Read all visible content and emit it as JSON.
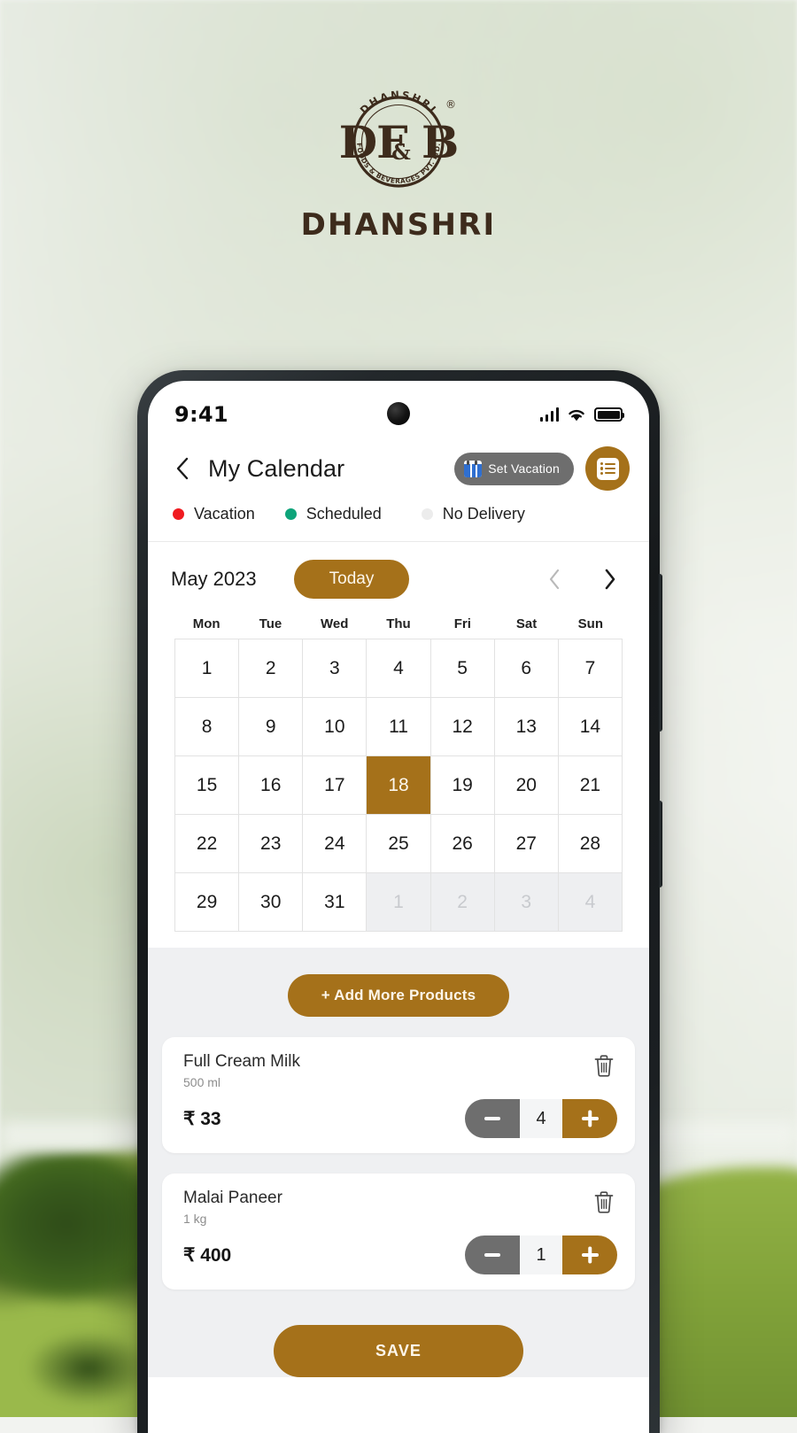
{
  "brand": {
    "logo_arc_top": "DHANSHRI",
    "logo_monogram": "DF&B",
    "logo_ampersand": "&",
    "logo_arc_bottom": "FOODS & BEVERAGES PVT. LTD.",
    "registered_mark": "®",
    "name": "DHANSHRI",
    "logo_color": "#3d2b1c"
  },
  "status_bar": {
    "time": "9:41",
    "signal_icon": "signal-bars-icon",
    "wifi_icon": "wifi-icon",
    "battery_icon": "battery-full-icon"
  },
  "header": {
    "back_icon": "chevron-left-icon",
    "title": "My Calendar",
    "set_vacation_label": "Set Vacation",
    "set_vacation_icon": "calendar-icon",
    "list_button_icon": "list-icon",
    "accent_color": "#A5711A",
    "pill_color": "#6E6E6E"
  },
  "legend": [
    {
      "label": "Vacation",
      "color": "#F01B20"
    },
    {
      "label": "Scheduled",
      "color": "#0EA47A"
    },
    {
      "label": "No  Delivery",
      "color": "#ECECEC"
    }
  ],
  "calendar": {
    "month_label": "May 2023",
    "today_label": "Today",
    "prev_icon": "chevron-left-icon",
    "next_icon": "chevron-right-icon",
    "weekdays": [
      "Mon",
      "Tue",
      "Wed",
      "Thu",
      "Fri",
      "Sat",
      "Sun"
    ],
    "selected_day": 18,
    "days": [
      {
        "n": "1",
        "muted": false
      },
      {
        "n": "2",
        "muted": false
      },
      {
        "n": "3",
        "muted": false
      },
      {
        "n": "4",
        "muted": false
      },
      {
        "n": "5",
        "muted": false
      },
      {
        "n": "6",
        "muted": false
      },
      {
        "n": "7",
        "muted": false
      },
      {
        "n": "8",
        "muted": false
      },
      {
        "n": "9",
        "muted": false
      },
      {
        "n": "10",
        "muted": false
      },
      {
        "n": "11",
        "muted": false
      },
      {
        "n": "12",
        "muted": false
      },
      {
        "n": "13",
        "muted": false
      },
      {
        "n": "14",
        "muted": false
      },
      {
        "n": "15",
        "muted": false
      },
      {
        "n": "16",
        "muted": false
      },
      {
        "n": "17",
        "muted": false
      },
      {
        "n": "18",
        "muted": false,
        "today": true
      },
      {
        "n": "19",
        "muted": false
      },
      {
        "n": "20",
        "muted": false
      },
      {
        "n": "21",
        "muted": false
      },
      {
        "n": "22",
        "muted": false
      },
      {
        "n": "23",
        "muted": false
      },
      {
        "n": "24",
        "muted": false
      },
      {
        "n": "25",
        "muted": false
      },
      {
        "n": "26",
        "muted": false
      },
      {
        "n": "27",
        "muted": false
      },
      {
        "n": "28",
        "muted": false
      },
      {
        "n": "29",
        "muted": false
      },
      {
        "n": "30",
        "muted": false
      },
      {
        "n": "31",
        "muted": false
      },
      {
        "n": "1",
        "muted": true
      },
      {
        "n": "2",
        "muted": true
      },
      {
        "n": "3",
        "muted": true
      },
      {
        "n": "4",
        "muted": true
      }
    ]
  },
  "products_section": {
    "add_more_label": "+ Add More Products",
    "delete_icon": "trash-icon",
    "minus_icon": "minus-icon",
    "plus_icon": "plus-icon",
    "items": [
      {
        "name": "Full Cream Milk",
        "unit": "500 ml",
        "price": "₹ 33",
        "qty": "4"
      },
      {
        "name": "Malai Paneer",
        "unit": "1 kg",
        "price": "₹ 400",
        "qty": "1"
      }
    ]
  },
  "footer": {
    "save_label": "SAVE"
  }
}
